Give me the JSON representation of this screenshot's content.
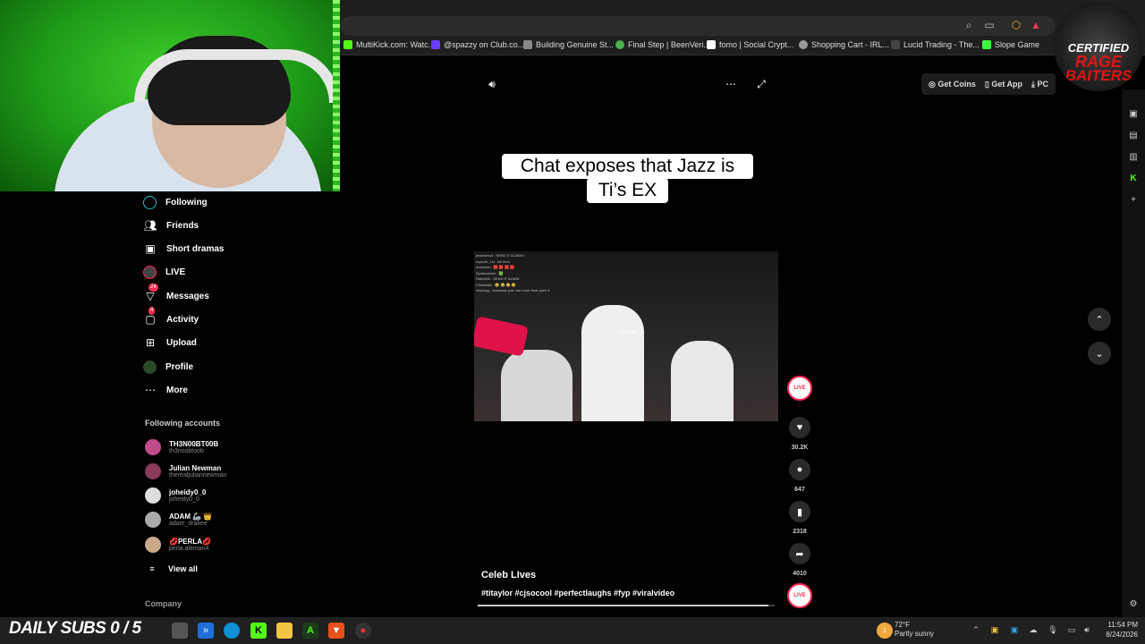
{
  "bookmarks": [
    {
      "label": "MultiKick.com: Watc...",
      "color": "#53fc18"
    },
    {
      "label": "@spazzy on Club.co...",
      "color": "#6a3cff"
    },
    {
      "label": "Building Genuine St...",
      "color": "#888888"
    },
    {
      "label": "Final Step | BeenVeri...",
      "color": "#4caf50"
    },
    {
      "label": "fomo | Social Crypt...",
      "color": "#ffffff"
    },
    {
      "label": "Shopping Cart - IRL...",
      "color": "#999999"
    },
    {
      "label": "Lucid Trading - The...",
      "color": "#444444"
    },
    {
      "label": "Slope Game",
      "color": "#3cff3c"
    }
  ],
  "logo": {
    "line1": "CERTIFIED",
    "line2": "RAGE",
    "line3": "BAITERS"
  },
  "tiktok_actions": {
    "get_coins": "Get Coins",
    "get_app": "Get App",
    "pc": "PC"
  },
  "sidebar": {
    "items": [
      {
        "label": "Following",
        "icon": "following-icon"
      },
      {
        "label": "Friends",
        "icon": "friends-icon"
      },
      {
        "label": "Short dramas",
        "icon": "short-dramas-icon"
      },
      {
        "label": "LIVE",
        "icon": "live-icon"
      },
      {
        "label": "Messages",
        "icon": "messages-icon",
        "badge": "24"
      },
      {
        "label": "Activity",
        "icon": "activity-icon",
        "badge": "4"
      },
      {
        "label": "Upload",
        "icon": "upload-icon"
      },
      {
        "label": "Profile",
        "icon": "profile-icon"
      },
      {
        "label": "More",
        "icon": "more-icon"
      }
    ],
    "following_title": "Following accounts",
    "accounts": [
      {
        "name": "TH3N00BT00B",
        "user": "th3noobtoob"
      },
      {
        "name": "Julian Newman",
        "user": "therealjuliannewman"
      },
      {
        "name": "joheidy0_0",
        "user": "joheidy0_0"
      },
      {
        "name": "ADAM 🦾 👑",
        "user": "adam_drakee"
      },
      {
        "name": "💋PERLA💋",
        "user": "perla.aleman4"
      }
    ],
    "view_all": "View all",
    "company": "Company"
  },
  "video": {
    "caption_line1": "Chat exposes that Jazz is",
    "caption_line2": "Ti’s EX",
    "chat_lines": [
      "jessewhud : SEND IT AGAIN!!!",
      "mysore_1st : loll hhrs",
      "dovemon : 🟥 🟥 🟥 🟥",
      "Spottamimel : 🟩",
      "Rabbit42 : SEND IT AGAIN",
      "Chefandis : 😂 😂 😂 😂",
      "whazzyy : someone just one more time open it"
    ],
    "tip_text": "zipped $2",
    "author": "Celeb LIves",
    "description": "#titaylor #cjsocool #perfectlaughs #fyp #viralvideo",
    "progress": 0.98,
    "likes": "30.2K",
    "comments": "647",
    "saves": "2318",
    "shares": "4010",
    "live_label": "LIVE"
  },
  "taskbar": {
    "subs_text": "DAILY SUBS 0 / 5",
    "temp": "72°F",
    "weather": "Partly sunny",
    "weather_badge": "1",
    "time": "11:54 PM",
    "date": "8/24/2026"
  }
}
